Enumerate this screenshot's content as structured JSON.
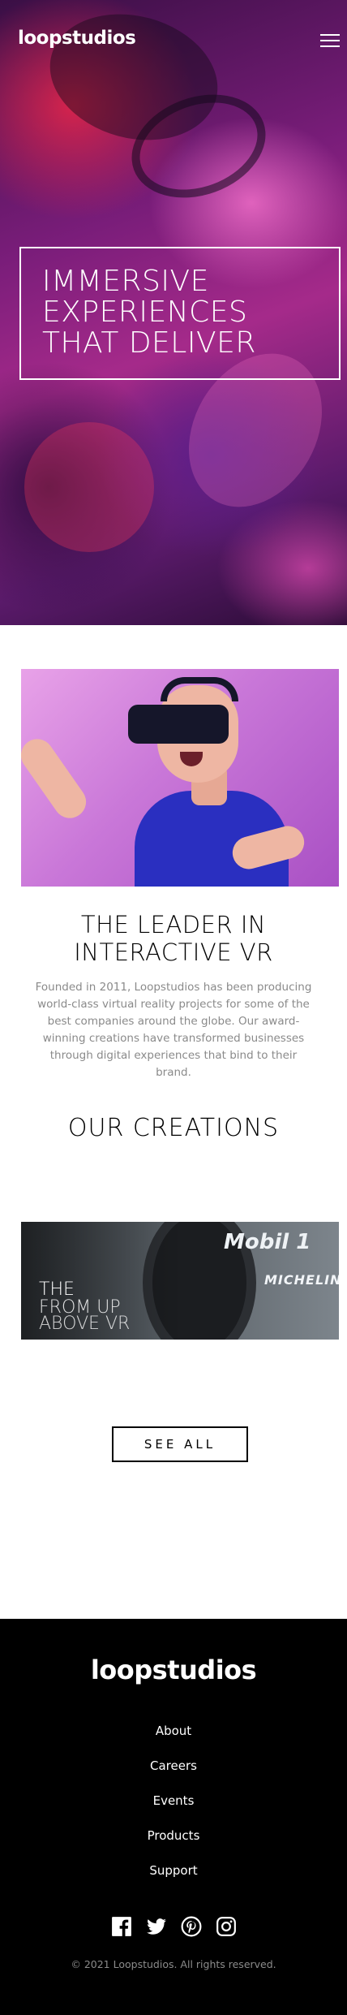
{
  "header": {
    "logo": "loopstudios",
    "menu_icon": "hamburger-menu-icon"
  },
  "hero": {
    "title": "Immersive experiences that deliver"
  },
  "intro": {
    "image_alt": "man wearing VR headset",
    "title": "The leader in interactive VR",
    "text": "Founded in 2011, Loopstudios has been producing world-class virtual reality projects for some of the best companies around the globe. Our award-winning creations have transformed businesses through digital experiences that bind to their brand."
  },
  "creations": {
    "title": "Our creations",
    "card_lines": [
      "The",
      "From up",
      "Above VR"
    ],
    "card_brands": [
      "Mobil 1",
      "MICHELIN"
    ],
    "see_all_label": "SEE ALL"
  },
  "footer": {
    "logo": "loopstudios",
    "nav": [
      "About",
      "Careers",
      "Events",
      "Products",
      "Support"
    ],
    "socials": [
      "facebook-icon",
      "twitter-icon",
      "pinterest-icon",
      "instagram-icon"
    ],
    "copyright": "© 2021 Loopstudios. All rights reserved."
  }
}
